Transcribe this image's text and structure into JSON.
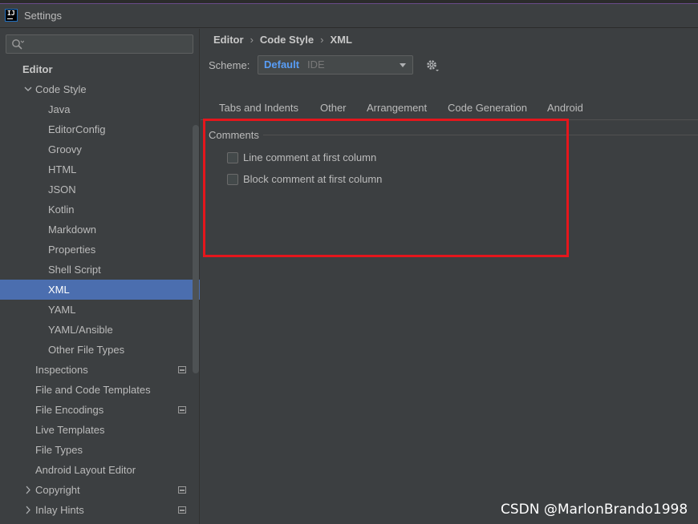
{
  "window": {
    "title": "Settings",
    "app_icon_text": "IJ"
  },
  "search": {
    "placeholder": "",
    "value": ""
  },
  "sidebar": {
    "items": [
      {
        "label": "Editor",
        "kind": "section"
      },
      {
        "label": "Code Style",
        "kind": "expanded"
      },
      {
        "label": "Java",
        "kind": "child"
      },
      {
        "label": "EditorConfig",
        "kind": "child"
      },
      {
        "label": "Groovy",
        "kind": "child"
      },
      {
        "label": "HTML",
        "kind": "child"
      },
      {
        "label": "JSON",
        "kind": "child"
      },
      {
        "label": "Kotlin",
        "kind": "child"
      },
      {
        "label": "Markdown",
        "kind": "child"
      },
      {
        "label": "Properties",
        "kind": "child"
      },
      {
        "label": "Shell Script",
        "kind": "child"
      },
      {
        "label": "XML",
        "kind": "child",
        "selected": true
      },
      {
        "label": "YAML",
        "kind": "child"
      },
      {
        "label": "YAML/Ansible",
        "kind": "child"
      },
      {
        "label": "Other File Types",
        "kind": "child"
      },
      {
        "label": "Inspections",
        "kind": "item",
        "project_icon": true
      },
      {
        "label": "File and Code Templates",
        "kind": "item"
      },
      {
        "label": "File Encodings",
        "kind": "item",
        "project_icon": true
      },
      {
        "label": "Live Templates",
        "kind": "item"
      },
      {
        "label": "File Types",
        "kind": "item"
      },
      {
        "label": "Android Layout Editor",
        "kind": "item"
      },
      {
        "label": "Copyright",
        "kind": "collapsed",
        "project_icon": true
      },
      {
        "label": "Inlay Hints",
        "kind": "collapsed",
        "project_icon": true
      }
    ]
  },
  "breadcrumb": {
    "part1": "Editor",
    "part2": "Code Style",
    "part3": "XML",
    "separator": "›"
  },
  "scheme": {
    "label": "Scheme:",
    "value": "Default",
    "sub": "IDE"
  },
  "tabs": [
    "Tabs and Indents",
    "Other",
    "Arrangement",
    "Code Generation",
    "Android"
  ],
  "comments": {
    "title": "Comments",
    "options": [
      {
        "label": "Line comment at first column",
        "checked": false
      },
      {
        "label": "Block comment at first column",
        "checked": false
      }
    ]
  },
  "colors": {
    "accent": "#4b6eaf",
    "link_blue": "#589df6",
    "highlight_frame": "#e5161c",
    "background": "#3c3f41"
  },
  "watermark": "CSDN @MarlonBrando1998"
}
